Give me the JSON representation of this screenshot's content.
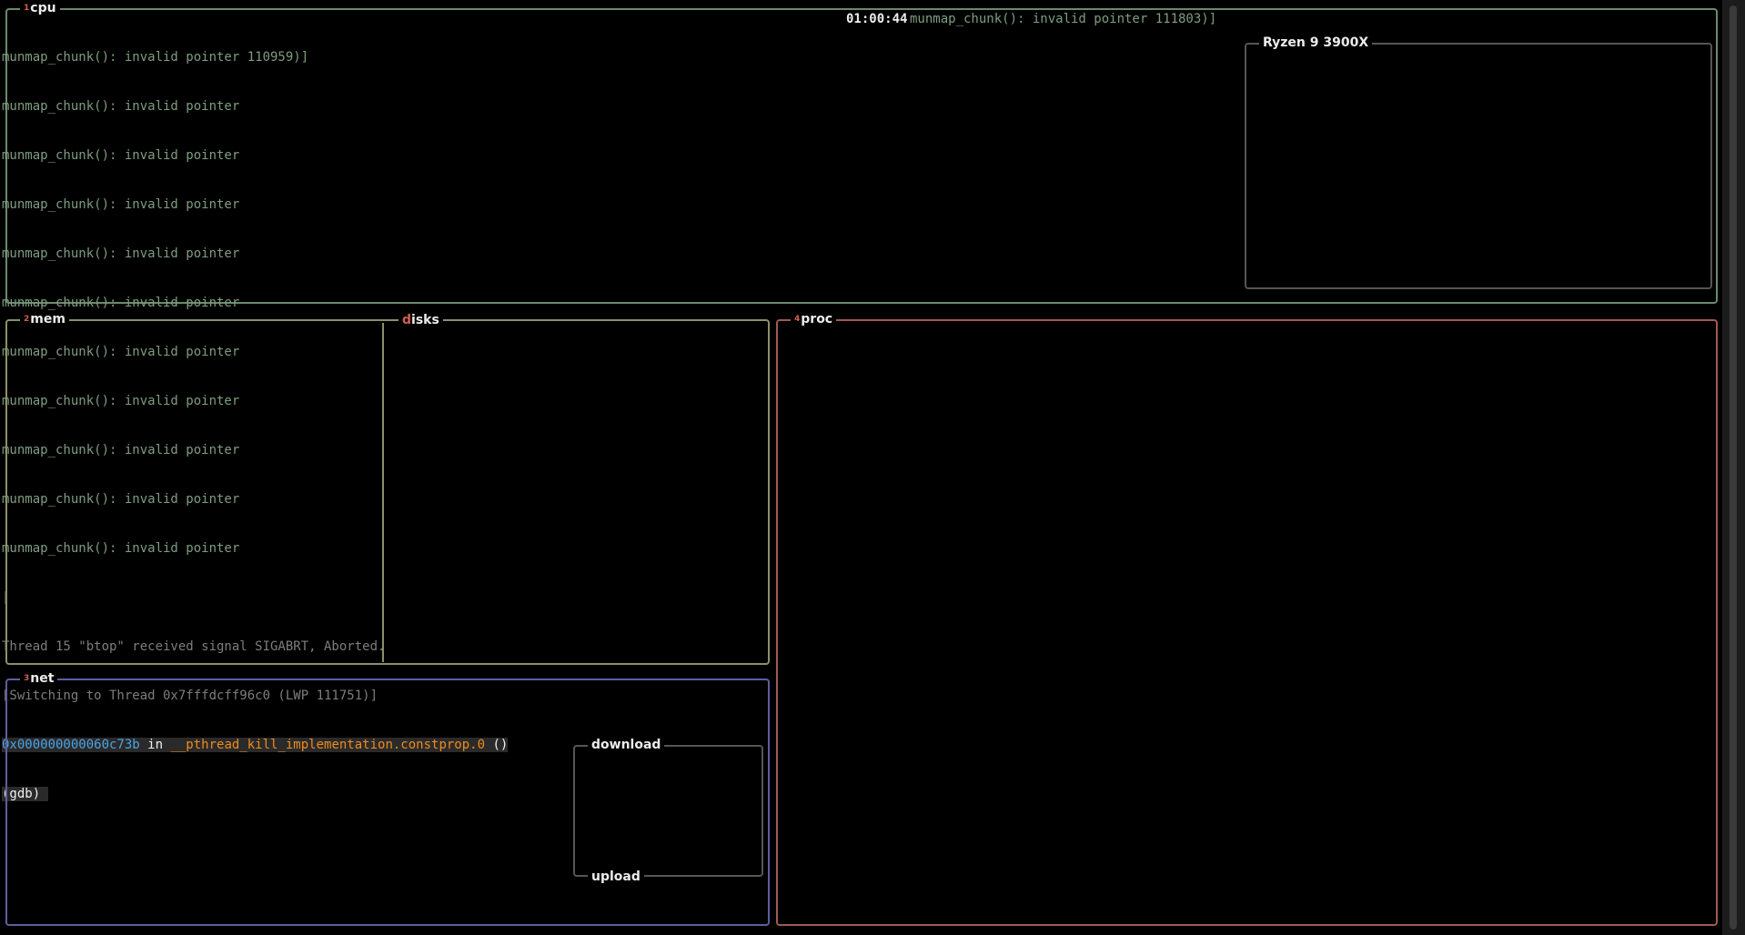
{
  "cpu": {
    "num": "1",
    "label": "cpu",
    "clock": "01:00:44",
    "header_msg": "munmap_chunk(): invalid pointer 111803)]",
    "cpu_model": "Ryzen 9 3900X"
  },
  "gdb": {
    "first_line": "munmap_chunk(): invalid pointer 110959)]",
    "repeat_line": "munmap_chunk(): invalid pointer",
    "repeat_lines": [
      "munmap_chunk(): invalid pointer",
      "munmap_chunk(): invalid pointer",
      "munmap_chunk(): invalid pointer",
      "munmap_chunk(): invalid pointer",
      "munmap_chunk(): invalid pointer",
      "munmap_chunk(): invalid pointer",
      "munmap_chunk(): invalid pointer",
      "munmap_chunk(): invalid pointer",
      "munmap_chunk(): invalid pointer",
      "munmap_chunk(): invalid pointer"
    ],
    "cursor": "|",
    "signal_line": "Thread 15 \"btop\" received signal SIGABRT, Aborted.",
    "switch_line": "[Switching to Thread 0x7fffdcff96c0 (LWP 111751)]",
    "address": "0x000000000060c73b",
    "in_word": " in ",
    "function": "__pthread_kill_implementation.constprop.0",
    "parens": " ()",
    "prompt": "(gdb) "
  },
  "mem": {
    "num": "2",
    "label": "mem"
  },
  "disks": {
    "hot": "d",
    "rest": "isks"
  },
  "proc": {
    "num": "4",
    "label": "proc"
  },
  "net": {
    "num": "3",
    "label": "net",
    "download": "download",
    "upload": "upload"
  }
}
